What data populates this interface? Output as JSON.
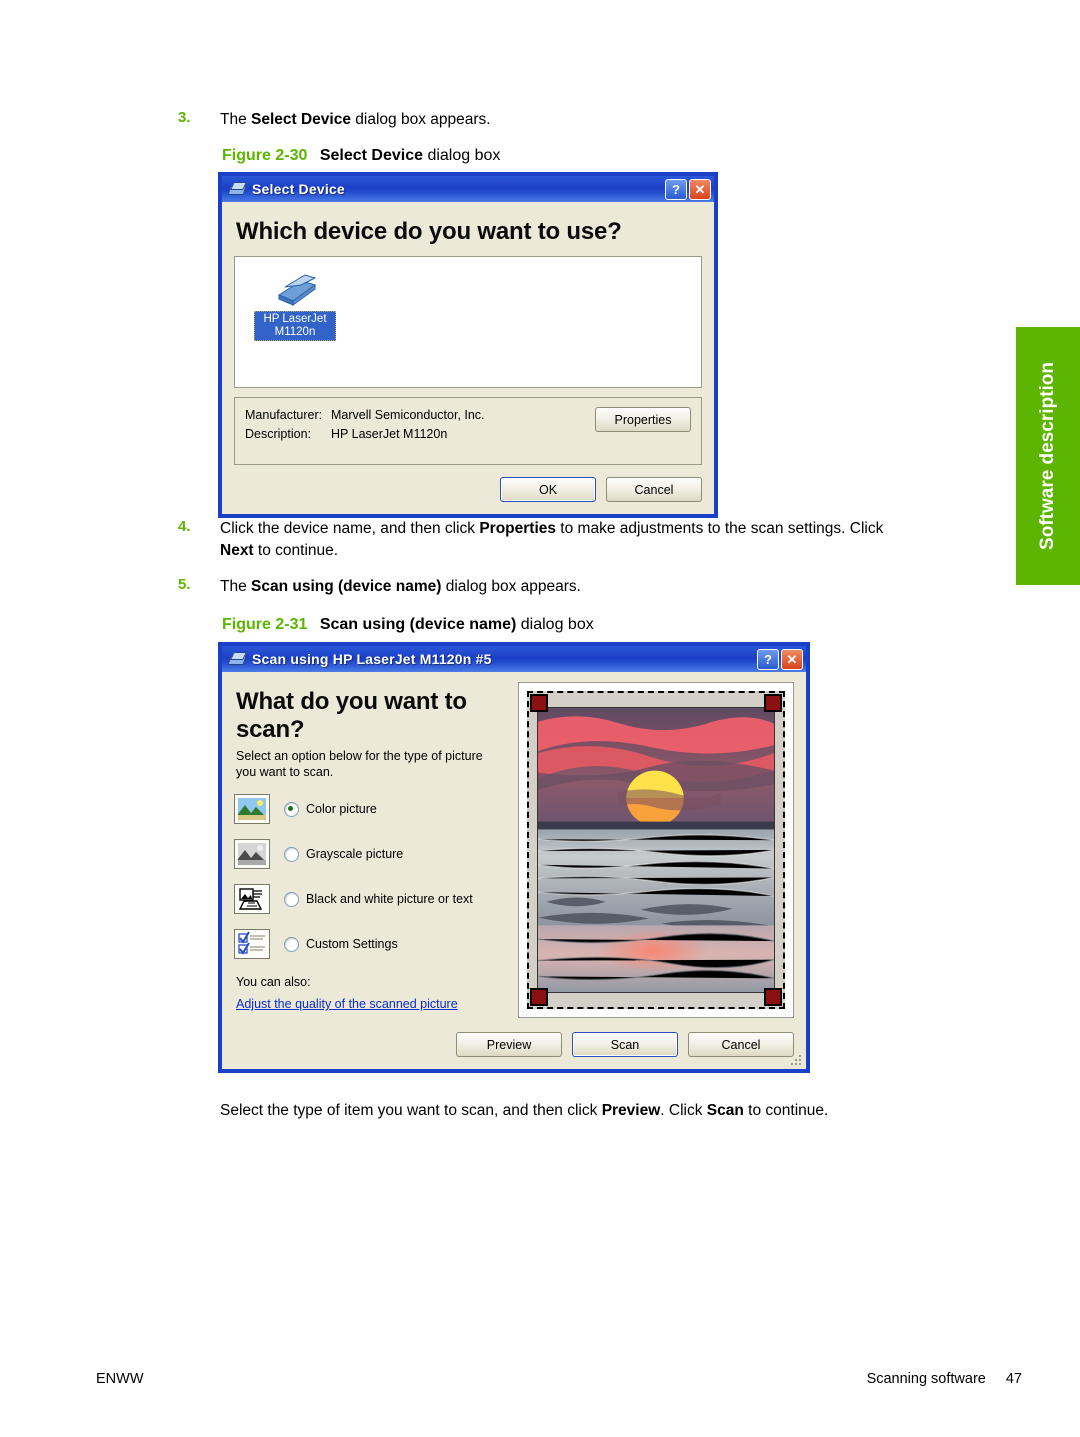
{
  "page": {
    "footer_left": "ENWW",
    "footer_right_label": "Scanning software",
    "footer_page_number": "47",
    "side_tab_label": "Software description",
    "accent_green": "#5CB500",
    "dialog_blue": "#1B40C8"
  },
  "steps": [
    {
      "number": "3.",
      "text_before": "The ",
      "bold": "Select Device",
      "text_after": " dialog box appears."
    },
    {
      "number": "4.",
      "line1_before": "Click the device name, and then click ",
      "line1_bold": "Properties",
      "line1_after": " to make adjustments to the scan settings. Click",
      "line2_bold": "Next",
      "line2_after": " to continue."
    },
    {
      "number": "5.",
      "text_before": "The ",
      "bold": "Scan using (device name)",
      "text_after": " dialog box appears."
    }
  ],
  "figures": [
    {
      "num": "Figure 2-30",
      "title": "Select Device",
      "suffix": " dialog box"
    },
    {
      "num": "Figure 2-31",
      "title": "Scan using (device name)",
      "suffix": " dialog box"
    }
  ],
  "select_device_dialog": {
    "title": "Select Device",
    "help_glyph": "?",
    "close_glyph": "✕",
    "heading": "Which device do you want to use?",
    "device": {
      "label_line1": "HP LaserJet",
      "label_line2": "M1120n"
    },
    "info": [
      {
        "key": "Manufacturer:",
        "value": "Marvell Semiconductor, Inc."
      },
      {
        "key": "Description:",
        "value": "HP LaserJet M1120n"
      }
    ],
    "properties_button": "Properties",
    "ok_button": "OK",
    "cancel_button": "Cancel"
  },
  "scan_dialog": {
    "title": "Scan using HP LaserJet M1120n #5",
    "help_glyph": "?",
    "close_glyph": "✕",
    "heading": "What do you want to scan?",
    "subtext": "Select an option below for the type of picture you want to scan.",
    "options": [
      {
        "label": "Color picture",
        "selected": true
      },
      {
        "label": "Grayscale picture",
        "selected": false
      },
      {
        "label": "Black and white picture or text",
        "selected": false
      },
      {
        "label": "Custom Settings",
        "selected": false
      }
    ],
    "also_label": "You can also:",
    "also_link": "Adjust the quality of the scanned picture",
    "preview_button": "Preview",
    "scan_button": "Scan",
    "cancel_button": "Cancel"
  },
  "closing_text": {
    "before": "Select the type of item you want to scan, and then click ",
    "bold1": "Preview",
    "middle": ". Click ",
    "bold2": "Scan",
    "after": " to continue."
  }
}
